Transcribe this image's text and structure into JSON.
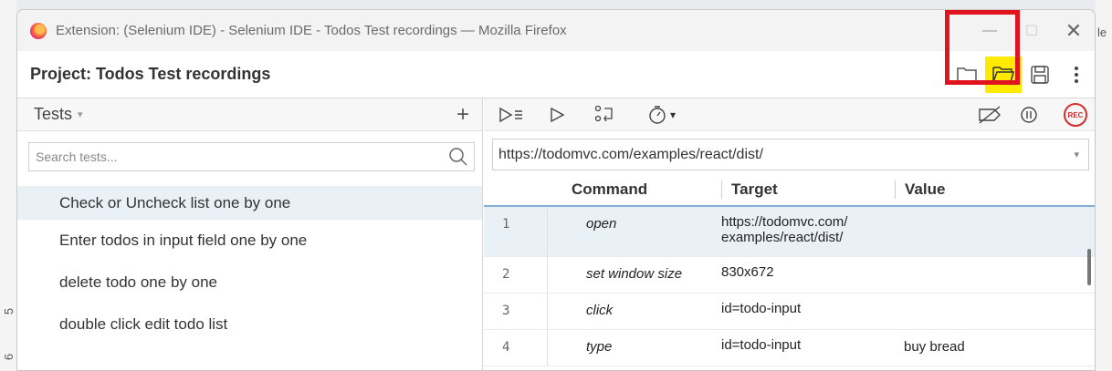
{
  "window": {
    "title": "Extension: (Selenium IDE) - Selenium IDE - Todos Test recordings — Mozilla Firefox",
    "minimize": "—",
    "maximize": "☐",
    "close": "✕"
  },
  "project": {
    "label": "Project:  Todos Test recordings"
  },
  "tests_panel": {
    "header": "Tests",
    "caret": "▾",
    "add": "+",
    "search_placeholder": "Search tests...",
    "items": [
      "Check or Uncheck list one by one",
      "Enter todos in input field one by one",
      "delete todo one by one",
      "double click edit todo list"
    ]
  },
  "editor": {
    "speed_caret": "▾",
    "rec_label": "REC",
    "base_url": "https://todomvc.com/examples/react/dist/",
    "url_caret": "▾",
    "columns": {
      "command": "Command",
      "target": "Target",
      "value": "Value"
    },
    "rows": [
      {
        "num": "1",
        "command": "open",
        "target_line1": "https://todomvc.com/",
        "target_line2": "examples/react/dist/",
        "value": ""
      },
      {
        "num": "2",
        "command": "set window size",
        "target_line1": "830x672",
        "target_line2": "",
        "value": ""
      },
      {
        "num": "3",
        "command": "click",
        "target_line1": "id=todo-input",
        "target_line2": "",
        "value": ""
      },
      {
        "num": "4",
        "command": "type",
        "target_line1": "id=todo-input",
        "target_line2": "",
        "value": "buy bread"
      }
    ]
  },
  "edge": {
    "right_char": "le",
    "left_top": "5",
    "left_bottom": "6"
  },
  "colors": {
    "highlight": "#e0141e",
    "folder_fill": "#ffea00",
    "rec": "#d92c2c"
  }
}
